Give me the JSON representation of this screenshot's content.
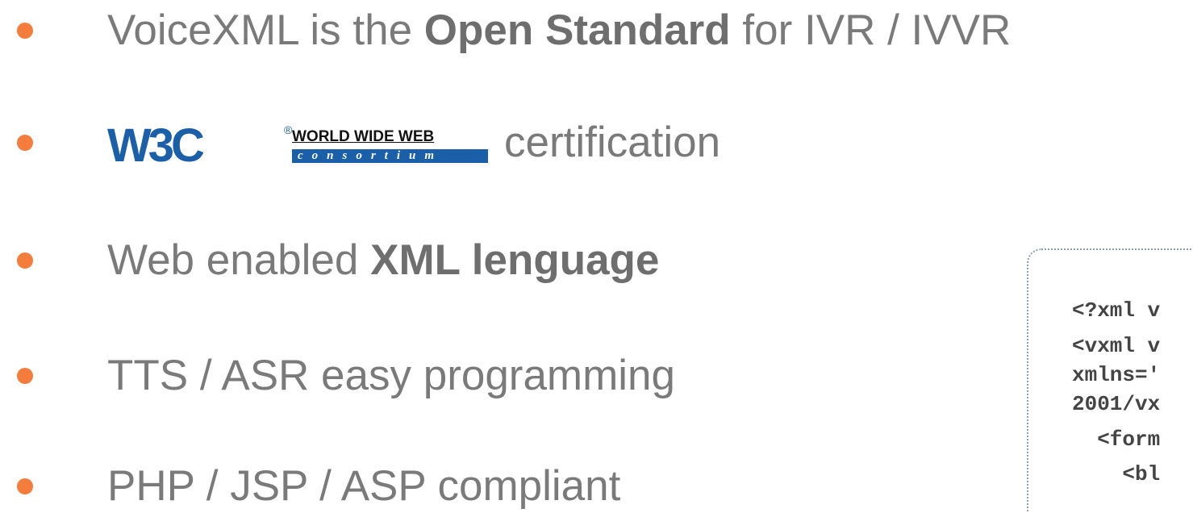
{
  "colors": {
    "bullet": "#f47c3c",
    "text": "#7a7a7a",
    "w3c_blue": "#1a5fa8"
  },
  "bullets": [
    {
      "parts": [
        "VoiceXML is the ",
        "Open Standard",
        " for IVR / IVVR"
      ]
    },
    {
      "logo": {
        "letters": "W3C",
        "mark": "®",
        "top": "WORLD WIDE WEB",
        "bottom": "consortium"
      },
      "text": "certification"
    },
    {
      "parts": [
        "Web enabled ",
        "XML lenguage"
      ]
    },
    {
      "text": "TTS / ASR easy programming"
    },
    {
      "text": "PHP / JSP / ASP compliant"
    }
  ],
  "code": {
    "lines": [
      "<?xml v",
      "<vxml v",
      "xmlns='",
      "2001/vx",
      "  <form",
      "    <bl"
    ]
  }
}
